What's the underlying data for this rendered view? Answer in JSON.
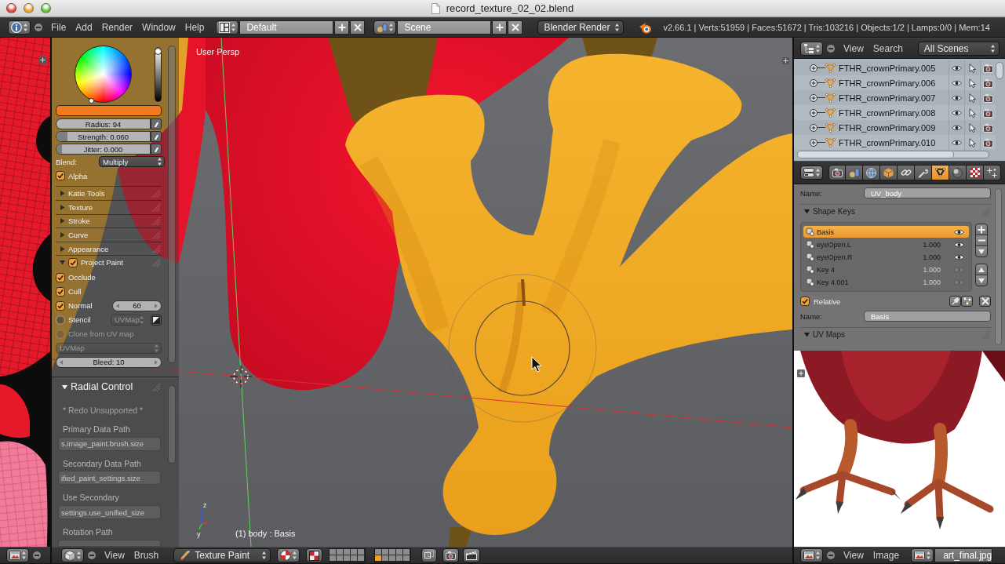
{
  "window": {
    "title": "record_texture_02_02.blend"
  },
  "info_header": {
    "menus": [
      "File",
      "Add",
      "Render",
      "Window",
      "Help"
    ],
    "screen_layout": "Default",
    "scene": "Scene",
    "render_engine": "Blender Render",
    "stats": "v2.66.1 | Verts:51959 | Faces:51672 | Tris:103216 | Objects:1/2 | Lamps:0/0 | Mem:14"
  },
  "tool_shelf": {
    "color_value": {
      "level": 1
    },
    "brush_fields": [
      {
        "kind": "number",
        "label": "Radius: 94"
      },
      {
        "kind": "slider",
        "label": "Strength: 0.060",
        "level": 0.06
      },
      {
        "kind": "slider",
        "label": "Jitter: 0.000",
        "level": 0
      }
    ],
    "blend": {
      "label": "Blend:",
      "value": "Multiply"
    },
    "alpha": {
      "label": "Alpha",
      "checked": true
    },
    "panels": [
      {
        "title": "Katie Tools",
        "expanded": false
      },
      {
        "title": "Texture",
        "expanded": false
      },
      {
        "title": "Stroke",
        "expanded": false
      },
      {
        "title": "Curve",
        "expanded": false
      },
      {
        "title": "Appearance",
        "expanded": false
      },
      {
        "title": "Project Paint",
        "expanded": true,
        "checked": true,
        "options": [
          {
            "kind": "checkbox",
            "label": "Occlude",
            "checked": true,
            "disabled": false
          },
          {
            "kind": "checkbox",
            "label": "Cull",
            "checked": true,
            "disabled": false
          },
          {
            "kind": "checkbox_number",
            "label": "Normal",
            "checked": true,
            "value": "60",
            "disabled": false
          },
          {
            "kind": "checkbox_select",
            "label": "Stencil",
            "checked": false,
            "value": "UVMap",
            "disabled": false
          },
          {
            "kind": "checkbox",
            "label": "Clone from UV map",
            "checked": false,
            "disabled": true
          },
          {
            "kind": "select",
            "value": "UVMap",
            "disabled": true
          },
          {
            "kind": "number",
            "value": "Bleed: 10",
            "disabled": false
          }
        ]
      }
    ]
  },
  "redo_panel": {
    "title": "Radial Control",
    "expanded": true,
    "note": "* Redo Unsupported *",
    "fields": [
      {
        "label": "Primary Data Path",
        "value": "s.image_paint.brush.size"
      },
      {
        "label": "Secondary Data Path",
        "value": "ified_paint_settings.size"
      },
      {
        "label": "Use Secondary",
        "value": "settings.use_unified_size"
      },
      {
        "label": "Rotation Path"
      }
    ]
  },
  "viewport": {
    "view_name": "User Persp",
    "object_info": "(1) body : Basis",
    "axis_labels": [
      "z",
      "y"
    ]
  },
  "viewport_header": {
    "menus": [
      "View",
      "Brush"
    ],
    "mode": "Texture Paint",
    "layers": [
      {
        "selected": false
      },
      {
        "selected": false
      },
      {
        "selected": false
      },
      {
        "selected": false
      },
      {
        "selected": false
      },
      {
        "selected": false
      },
      {
        "selected": false
      },
      {
        "selected": false
      },
      {
        "selected": false
      },
      {
        "selected": false
      },
      {
        "selected": false
      },
      {
        "selected": false
      },
      {
        "selected": false
      },
      {
        "selected": false
      },
      {
        "selected": false
      },
      {
        "selected": true
      },
      {
        "selected": false
      },
      {
        "selected": false
      },
      {
        "selected": false
      },
      {
        "selected": false
      }
    ]
  },
  "outliner": {
    "menus": [
      "View",
      "Search"
    ],
    "display_mode": "All Scenes",
    "rows": [
      {
        "name": "FTHR_crownPrimary.005"
      },
      {
        "name": "FTHR_crownPrimary.006"
      },
      {
        "name": "FTHR_crownPrimary.007"
      },
      {
        "name": "FTHR_crownPrimary.008"
      },
      {
        "name": "FTHR_crownPrimary.009"
      },
      {
        "name": "FTHR_crownPrimary.010"
      }
    ]
  },
  "properties": {
    "tabs": [
      {
        "kind": "render",
        "selected": false
      },
      {
        "kind": "scene",
        "selected": false
      },
      {
        "kind": "world",
        "selected": false
      },
      {
        "kind": "object",
        "selected": false
      },
      {
        "kind": "constraints",
        "selected": false
      },
      {
        "kind": "modifiers",
        "selected": false
      },
      {
        "kind": "data",
        "selected": true
      },
      {
        "kind": "material",
        "selected": false
      },
      {
        "kind": "texture",
        "selected": false
      },
      {
        "kind": "particles",
        "selected": false
      }
    ],
    "name": {
      "label": "Name:",
      "value": "UV_body"
    },
    "shape_keys": {
      "title": "Shape Keys",
      "expanded": true,
      "keys": [
        {
          "name": "Basis",
          "selected": true,
          "muted": false
        },
        {
          "name": "eyeOpen.L",
          "value": "1.000",
          "selected": false,
          "muted": false
        },
        {
          "name": "eyeOpen.R",
          "value": "1.000",
          "selected": false,
          "muted": false
        },
        {
          "name": "Key 4",
          "value": "1.000",
          "selected": false,
          "muted": true
        },
        {
          "name": "Key 4.001",
          "value": "1.000",
          "selected": false,
          "muted": true
        }
      ],
      "relative": {
        "label": "Relative",
        "checked": true
      },
      "reference": {
        "label": "Name:",
        "value": "Basis"
      }
    },
    "uv_maps": {
      "title": "UV Maps",
      "expanded": true
    }
  },
  "image_editor": {
    "menus": [
      "View",
      "Image"
    ],
    "image_name": "art_final.jpg"
  }
}
